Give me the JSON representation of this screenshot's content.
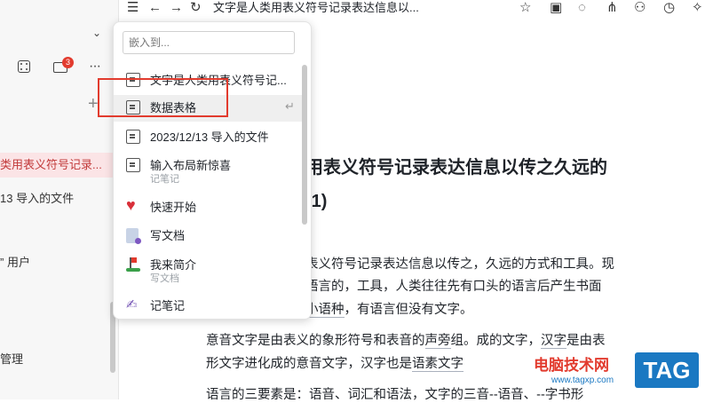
{
  "topbar": {
    "doc_title": "文字是人类用表义符号记录表达信息以...",
    "icons": [
      "menu-icon",
      "back-arrow-icon",
      "forward-arrow-icon",
      "refresh-icon",
      "star-icon",
      "present-icon",
      "comment-icon",
      "graph-icon",
      "share-user-icon",
      "history-icon",
      "magic-icon"
    ]
  },
  "sidebar": {
    "notification_count": "3",
    "items": [
      "类用表义符号记录...",
      "13 导入的文件",
      "” 用户",
      "管理"
    ]
  },
  "popup": {
    "search_placeholder": "嵌入到...",
    "items": [
      {
        "label": "文字是人类用表义符号记...",
        "sub": ""
      },
      {
        "label": "数据表格",
        "sub": ""
      },
      {
        "label": "2023/12/13 导入的文件",
        "sub": ""
      },
      {
        "label": "输入布局新惊喜",
        "sub": "记笔记"
      },
      {
        "label": "快速开始",
        "sub": ""
      },
      {
        "label": "写文档",
        "sub": ""
      },
      {
        "label": "我来简介",
        "sub": "写文档"
      },
      {
        "label": "记笔记",
        "sub": ""
      }
    ],
    "enter_hint": "↵"
  },
  "content": {
    "heading_line1": "用表义符号记录表达信息以传之久远的",
    "heading_line2": "(1)",
    "para1_line1": "表义符号记录表达信息以传之，久远的方式和工具。现",
    "para1_line2": "语言的，工具，人类往往先有口头的语言后产生书面",
    "para1_line3_link": "小语种",
    "para1_line3_rest": "，有语言但没有文字。",
    "para2_line1_a": "意音文字是由表义的象形符号和表音的",
    "para2_line1_link1": "声旁",
    "para2_line1_b": "组。成的文字，",
    "para2_line1_link2": "汉字",
    "para2_line1_c": "是由表",
    "para2_line2_a": "形文字进化成的意音文字，汉字也是",
    "para2_line2_link": "语素文字",
    "para3_line1": "语言的三要素是：语音、词汇和语法，文字的三音--语音、--字书形"
  },
  "watermark": {
    "site_name": "电脑技术网",
    "url": "www.tagxp.com",
    "tag": "TAG"
  },
  "colors": {
    "accent_red": "#e23b2e",
    "active_bg": "#fbe4e6",
    "tag_blue": "#1a78c2"
  }
}
